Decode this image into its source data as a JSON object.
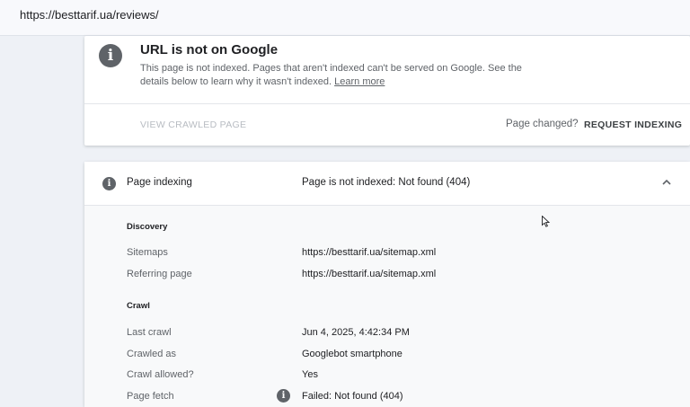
{
  "url_bar": {
    "url": "https://besttarif.ua/reviews/"
  },
  "status_card": {
    "title": "URL is not on Google",
    "description": "This page is not indexed. Pages that aren't indexed can't be served on Google. See the details below to learn why it wasn't indexed.",
    "learn_more": "Learn more",
    "view_crawled": "VIEW CRAWLED PAGE",
    "page_changed": "Page changed?",
    "request_indexing": "REQUEST INDEXING"
  },
  "indexing_card": {
    "label": "Page indexing",
    "status": "Page is not indexed: Not found (404)",
    "discovery": {
      "title": "Discovery",
      "sitemaps_label": "Sitemaps",
      "sitemaps_value": "https://besttarif.ua/sitemap.xml",
      "referring_label": "Referring page",
      "referring_value": "https://besttarif.ua/sitemap.xml"
    },
    "crawl": {
      "title": "Crawl",
      "last_crawl_label": "Last crawl",
      "last_crawl_value": "Jun 4, 2025, 4:42:34 PM",
      "crawled_as_label": "Crawled as",
      "crawled_as_value": "Googlebot smartphone",
      "allowed_label": "Crawl allowed?",
      "allowed_value": "Yes",
      "fetch_label": "Page fetch",
      "fetch_value": "Failed: Not found (404)"
    }
  },
  "colors": {
    "icon_gray": "#5f6368",
    "background": "#eef1f6",
    "panel": "#f8f9fa"
  }
}
